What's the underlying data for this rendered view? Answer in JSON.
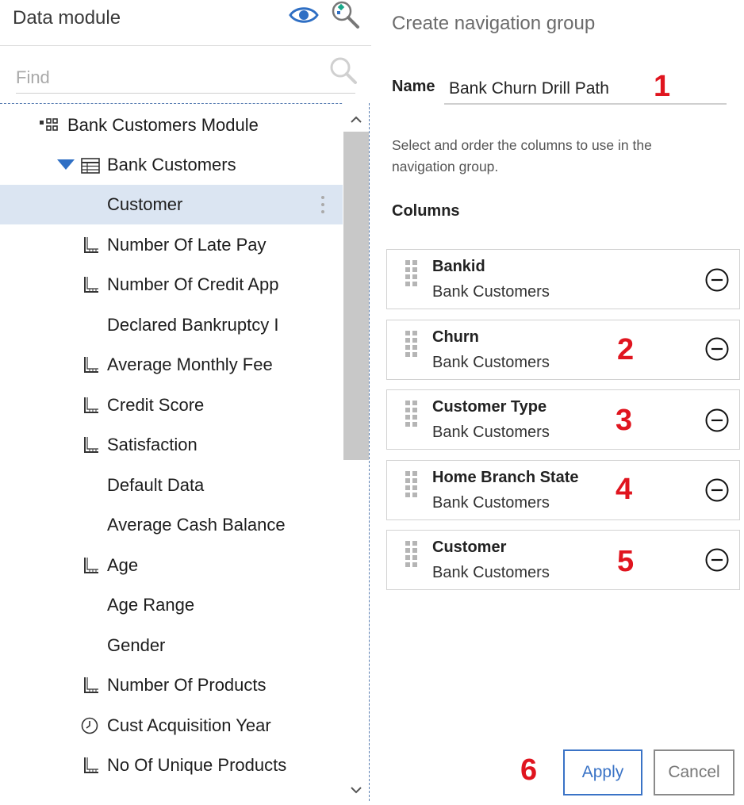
{
  "left_panel": {
    "title": "Data module",
    "find_placeholder": "Find",
    "tree": [
      {
        "label": "Bank Customers Module",
        "icon": "module-icon",
        "level": 0
      },
      {
        "label": "Bank Customers",
        "icon": "table-icon",
        "level": 1,
        "expanded": true
      },
      {
        "label": "Customer",
        "icon": "",
        "level": 2,
        "selected": true
      },
      {
        "label": "Number Of Late Pay",
        "icon": "measure-icon",
        "level": 2
      },
      {
        "label": "Number Of Credit App",
        "icon": "measure-icon",
        "level": 2
      },
      {
        "label": "Declared Bankruptcy I",
        "icon": "",
        "level": 2
      },
      {
        "label": "Average Monthly Fee",
        "icon": "measure-icon",
        "level": 2
      },
      {
        "label": "Credit Score",
        "icon": "measure-icon",
        "level": 2
      },
      {
        "label": "Satisfaction",
        "icon": "measure-icon",
        "level": 2
      },
      {
        "label": "Default Data",
        "icon": "",
        "level": 2
      },
      {
        "label": "Average Cash Balance",
        "icon": "",
        "level": 2
      },
      {
        "label": "Age",
        "icon": "measure-icon",
        "level": 2
      },
      {
        "label": "Age Range",
        "icon": "",
        "level": 2
      },
      {
        "label": "Gender",
        "icon": "",
        "level": 2
      },
      {
        "label": "Number Of Products",
        "icon": "measure-icon",
        "level": 2
      },
      {
        "label": "Cust Acquisition Year",
        "icon": "clock-icon",
        "level": 2
      },
      {
        "label": "No Of Unique Products",
        "icon": "measure-icon",
        "level": 2
      }
    ]
  },
  "right_panel": {
    "title": "Create navigation group",
    "name_label": "Name",
    "name_value": "Bank Churn Drill Path",
    "description": "Select and order the columns to use in the navigation group.",
    "columns_heading": "Columns",
    "columns": [
      {
        "name": "Bankid",
        "source": "Bank Customers"
      },
      {
        "name": "Churn",
        "source": "Bank Customers"
      },
      {
        "name": "Customer Type",
        "source": "Bank Customers"
      },
      {
        "name": "Home Branch State",
        "source": "Bank Customers"
      },
      {
        "name": "Customer",
        "source": "Bank Customers"
      }
    ],
    "apply_label": "Apply",
    "cancel_label": "Cancel"
  },
  "annotations": [
    "1",
    "2",
    "3",
    "4",
    "5",
    "6"
  ],
  "colors": {
    "annotation": "#e0151f",
    "accent": "#3a73c6",
    "selected_row": "#dbe5f2"
  }
}
